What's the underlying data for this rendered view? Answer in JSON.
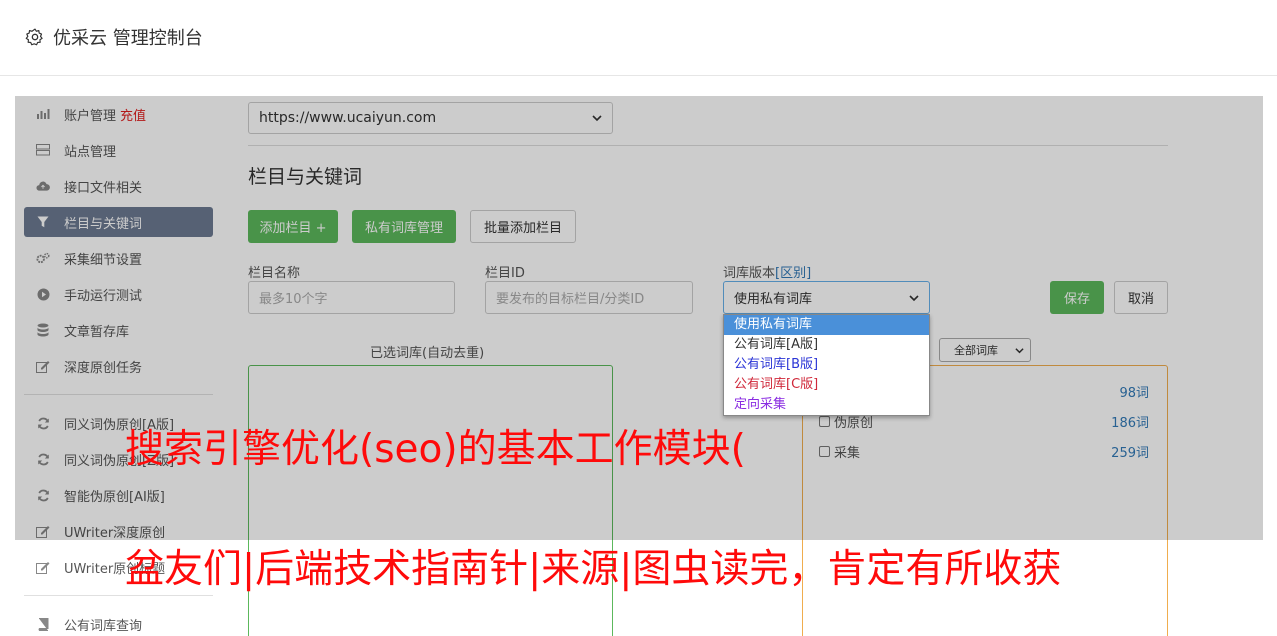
{
  "header": {
    "title": "优采云 管理控制台",
    "icon": "gear-icon"
  },
  "sidebar": {
    "items": [
      {
        "label": "账户管理",
        "badge": "充值",
        "icon": "bar-chart-icon"
      },
      {
        "label": "站点管理",
        "icon": "server-icon"
      },
      {
        "label": "接口文件相关",
        "icon": "cloud-upload-icon"
      },
      {
        "label": "栏目与关键词",
        "icon": "filter-icon"
      },
      {
        "label": "采集细节设置",
        "icon": "cogs-icon"
      },
      {
        "label": "手动运行测试",
        "icon": "play-circle-icon"
      },
      {
        "label": "文章暂存库",
        "icon": "database-icon"
      },
      {
        "label": "深度原创任务",
        "icon": "edit-icon"
      },
      {
        "label": "同义词伪原创[A版]",
        "icon": "refresh-icon"
      },
      {
        "label": "同义词伪原创[Z版]",
        "icon": "refresh-icon"
      },
      {
        "label": "智能伪原创[AI版]",
        "icon": "refresh-icon"
      },
      {
        "label": "UWriter深度原创",
        "icon": "edit-icon"
      },
      {
        "label": "UWriter原创标题",
        "icon": "edit-icon"
      },
      {
        "label": "公有词库查询",
        "icon": "book-icon"
      }
    ]
  },
  "main": {
    "site_select": "https://www.ucaiyun.com",
    "section_title": "栏目与关键词",
    "buttons": {
      "add_column": "添加栏目 +",
      "private_lib": "私有词库管理",
      "batch_add": "批量添加栏目",
      "save": "保存",
      "cancel": "取消"
    },
    "form": {
      "column_name_label": "栏目名称",
      "column_name_placeholder": "最多10个字",
      "column_id_label": "栏目ID",
      "column_id_placeholder": "要发布的目标栏目/分类ID",
      "lib_version_label": "词库版本",
      "lib_version_link": "[区别]",
      "lib_version_value": "使用私有词库"
    },
    "dropdown_options": [
      "使用私有词库",
      "公有词库[A版]",
      "公有词库[B版]",
      "公有词库[C版]",
      "定向采集"
    ],
    "selected_panel_title": "已选词库(自动去重)",
    "filter_select": "全部词库",
    "libraries": [
      {
        "name": "",
        "count": "98词"
      },
      {
        "name": "伪原创",
        "count": "186词"
      },
      {
        "name": "采集",
        "count": "259词"
      }
    ]
  },
  "banner": {
    "line1": "搜索引擎优化(seo)的基本工作模块(",
    "line2": "盆友们|后端技术指南针|来源|图虫读完，肯定有所收获"
  },
  "colors": {
    "green": "#5cb85c",
    "active_nav": "#6c7a91",
    "banner_red": "#ff0a0a",
    "link_blue": "#337ab7"
  }
}
